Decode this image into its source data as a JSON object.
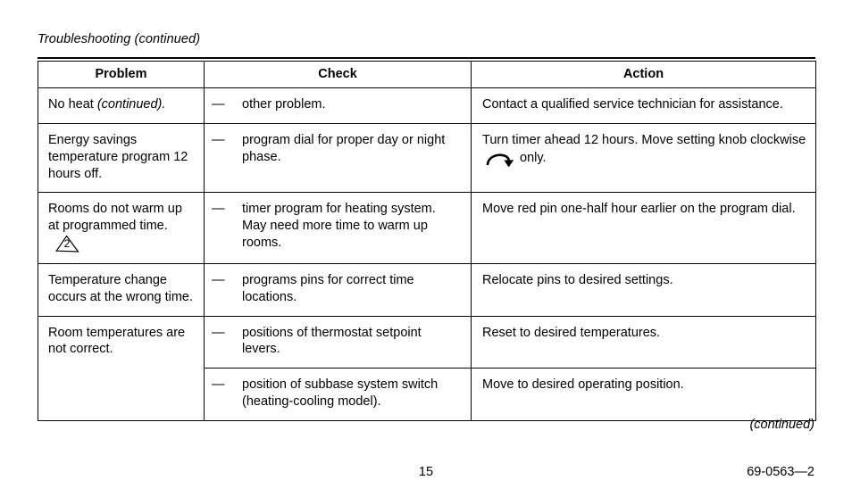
{
  "document": {
    "section_title": "Troubleshooting (continued)",
    "continued_note": "(continued)",
    "page_number": "15",
    "doc_number": "69-0563—2"
  },
  "table": {
    "headers": {
      "problem": "Problem",
      "check": "Check",
      "action": "Action"
    },
    "dash_bullet": "—",
    "rows": [
      {
        "problem_plain": "No heat ",
        "problem_italic": "(continued).",
        "check": "other problem.",
        "action": "Contact a qualified service technician for assistance."
      },
      {
        "problem_plain": "Energy savings temperature program 12 hours off.",
        "check": "program dial for proper day or night phase.",
        "action_before": "Turn timer ahead 12 hours. Move setting knob clockwise",
        "action_icon": "clockwise-rotation-arrow-icon",
        "action_after": "only."
      },
      {
        "problem_plain": "Rooms do not warm up at programmed time.",
        "problem_note_marker": "2",
        "check": "timer program for heating system. May need more time to warm up rooms.",
        "action": "Move red pin one-half hour earlier on the program dial."
      },
      {
        "problem_plain": "Temperature change occurs at the wrong time.",
        "check": "programs pins for correct time locations.",
        "action": "Relocate pins to desired settings."
      },
      {
        "problem_plain": "Room temperatures are not correct.",
        "check": "positions of thermostat setpoint levers.",
        "action": "Reset to desired temperatures."
      },
      {
        "problem_plain": "",
        "check": "position of subbase system switch (heating-cooling model).",
        "action": "Move to desired operating position."
      }
    ]
  },
  "colors": {
    "ink": "#000000",
    "paper": "#ffffff"
  }
}
